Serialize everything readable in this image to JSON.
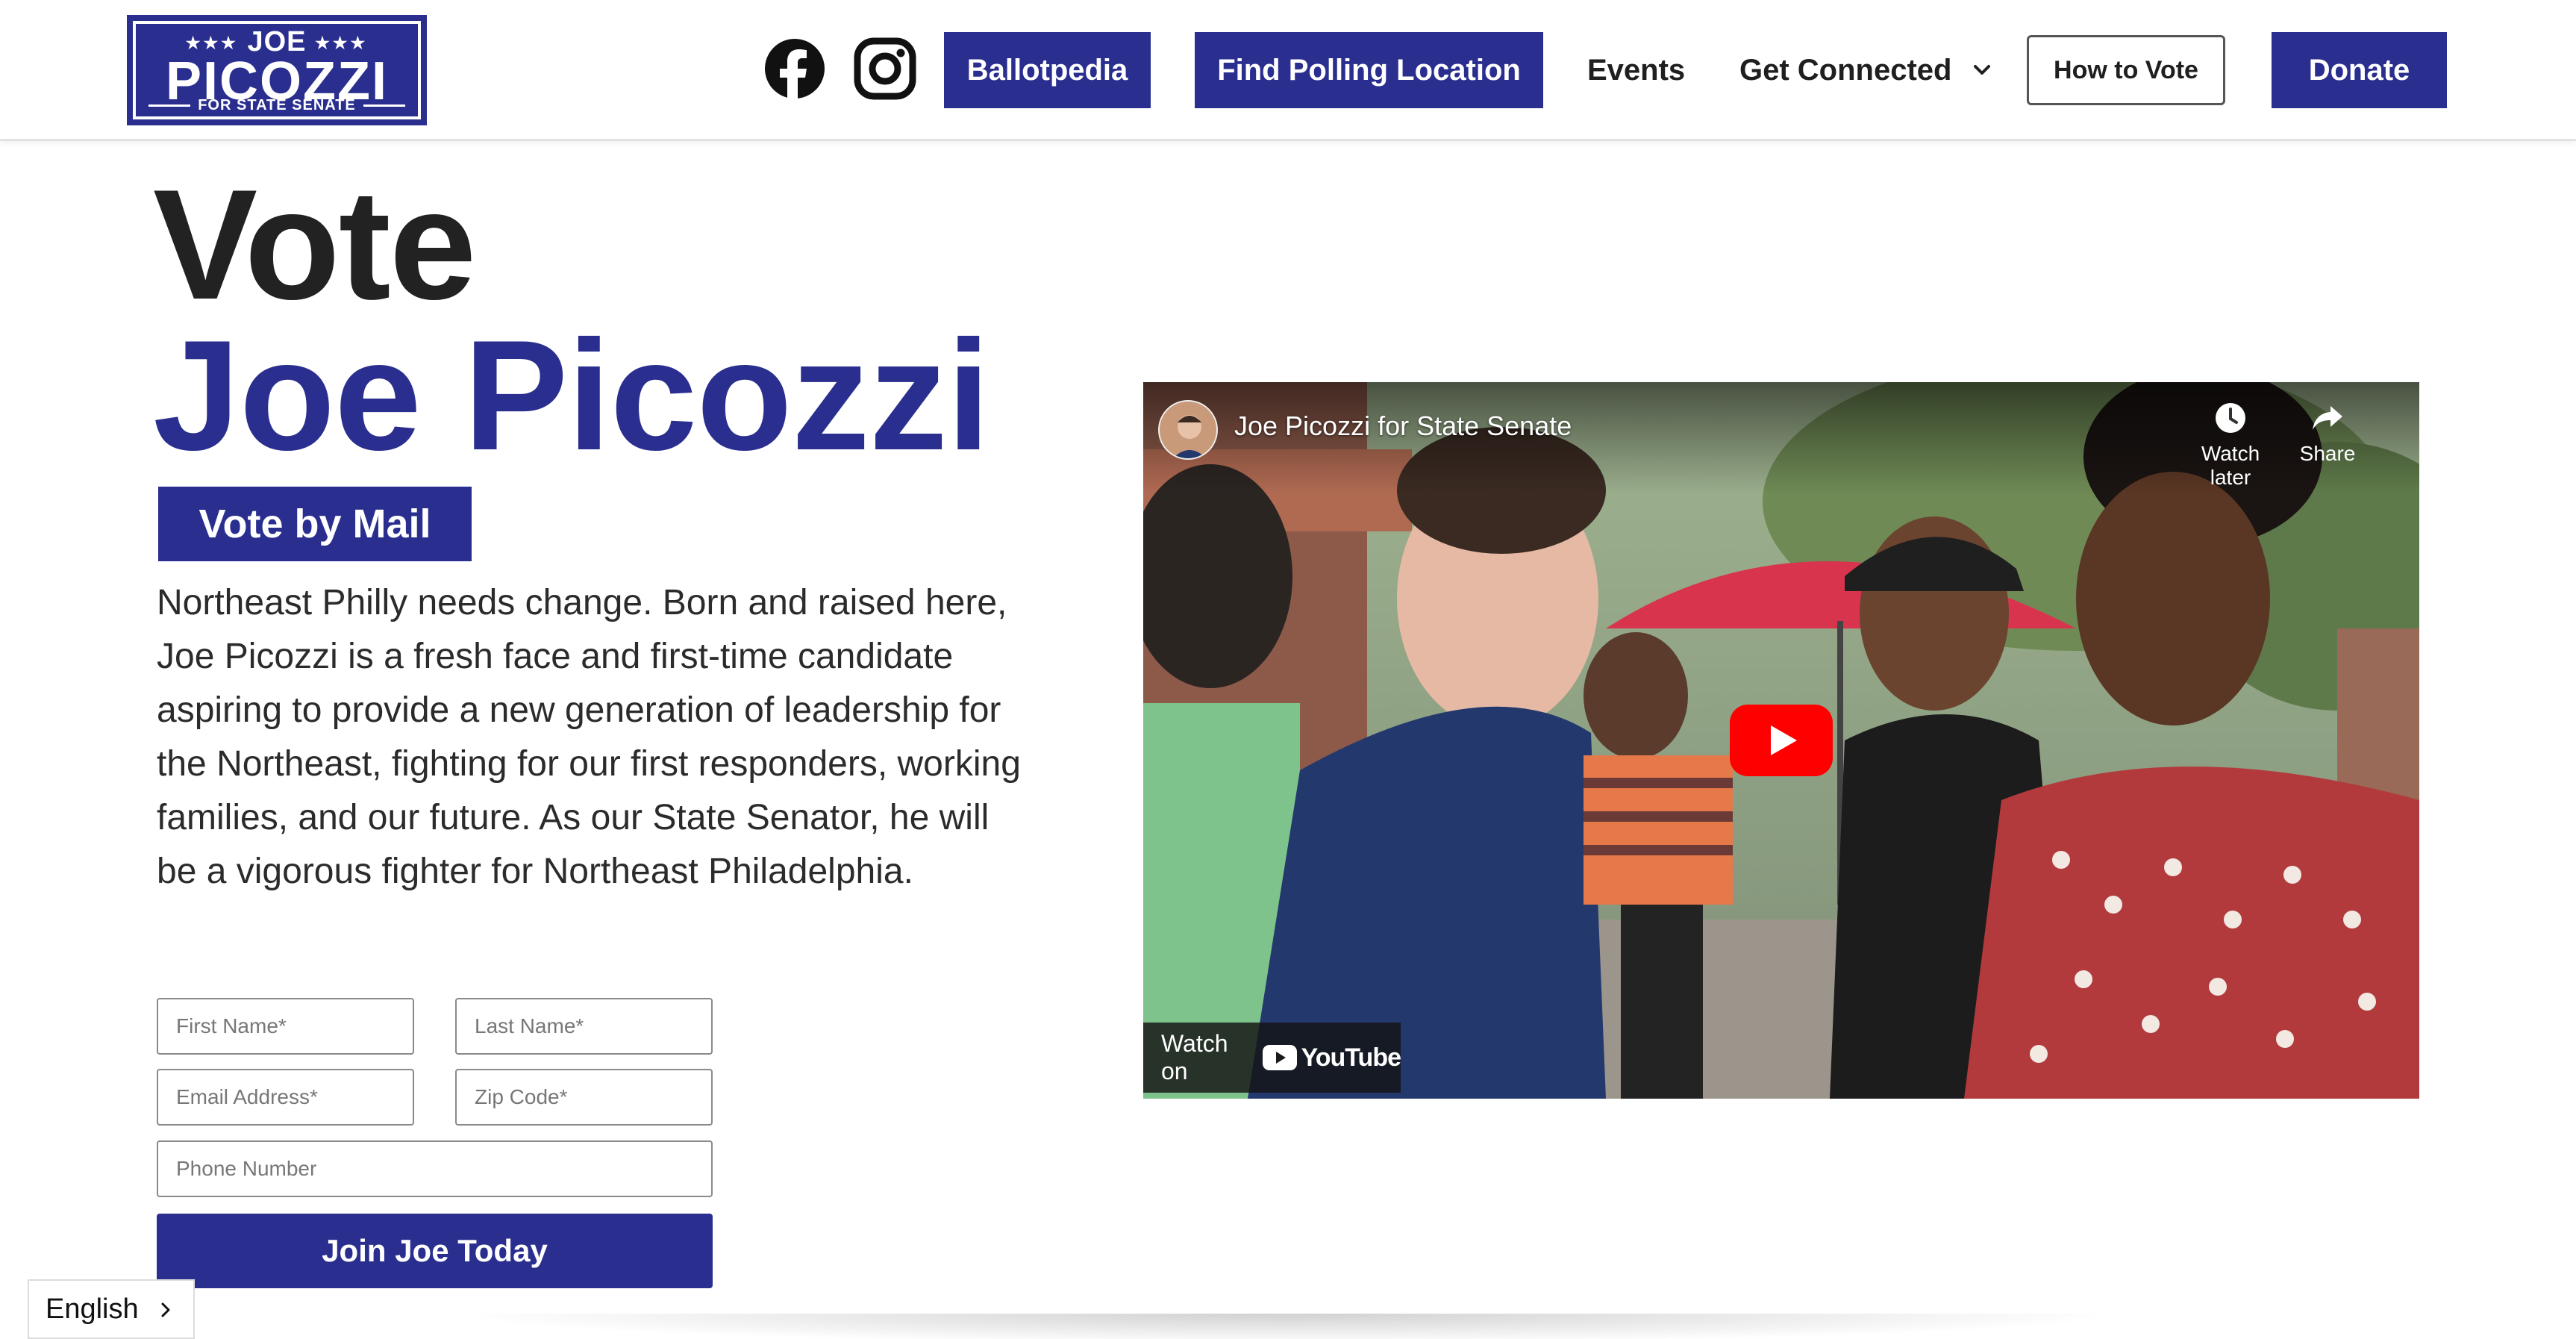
{
  "header": {
    "logo": {
      "top": "JOE",
      "name": "PICOZZI",
      "sub": "FOR STATE SENATE"
    },
    "social": [
      {
        "icon": "facebook-icon"
      },
      {
        "icon": "instagram-icon"
      }
    ],
    "nav": {
      "ballotpedia": "Ballotpedia",
      "polling": "Find Polling Location",
      "events": "Events",
      "get_connected": "Get Connected",
      "how_to_vote": "How to Vote",
      "donate": "Donate"
    }
  },
  "hero": {
    "line1": "Vote",
    "line2": "Joe Picozzi",
    "vote_by_mail": "Vote by Mail",
    "blurb": "Northeast Philly needs change. Born and raised here, Joe Picozzi is a fresh face and first-time candidate aspiring to provide a new generation of leadership for the Northeast, fighting for our first responders, working families, and our future. As our State Senator, he will be a vigorous fighter for Northeast Philadelphia."
  },
  "form": {
    "first_name": "First Name*",
    "last_name": "Last Name*",
    "email": "Email Address*",
    "zip": "Zip Code*",
    "phone": "Phone Number",
    "submit": "Join Joe Today"
  },
  "video": {
    "title": "Joe Picozzi for State Senate",
    "watch_later": "Watch later",
    "share": "Share",
    "watch_on": "Watch on",
    "youtube": "YouTube"
  },
  "language": {
    "selected": "English"
  },
  "colors": {
    "brand": "#2a2f8f",
    "youtube_red": "#ff0000"
  }
}
